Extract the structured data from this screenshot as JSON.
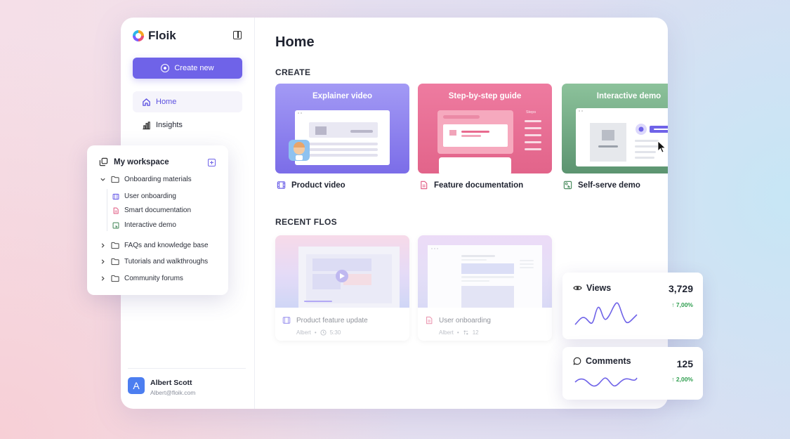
{
  "app": {
    "name": "Floik"
  },
  "sidebar": {
    "create_label": "Create new",
    "items": [
      {
        "label": "Home",
        "icon": "home-icon",
        "active": true
      },
      {
        "label": "Insights",
        "icon": "bar-chart-icon",
        "active": false
      }
    ],
    "user": {
      "initial": "A",
      "name": "Albert Scott",
      "email": "Albert@floik.com"
    }
  },
  "main": {
    "title": "Home",
    "create_heading": "CREATE",
    "create_cards": [
      {
        "title": "Explainer video",
        "label": "Product video",
        "icon": "film-icon",
        "color": "#8b7cf0"
      },
      {
        "title": "Step-by-step guide",
        "label": "Feature documentation",
        "icon": "document-icon",
        "color": "#e86a8e",
        "steps_caption": "Steps"
      },
      {
        "title": "Interactive demo",
        "label": "Self-serve demo",
        "icon": "interactive-icon",
        "color": "#6aa77e"
      }
    ],
    "recent_heading": "RECENT FLOS",
    "recent": [
      {
        "name": "Product feature update",
        "author": "Albert",
        "meta": "5:30",
        "icon": "film-icon",
        "meta_icon": "clock-icon"
      },
      {
        "name": "User onboarding",
        "author": "Albert",
        "meta": "12",
        "icon": "document-icon",
        "meta_icon": "steps-icon"
      }
    ]
  },
  "workspace": {
    "title": "My workspace",
    "folders": [
      {
        "label": "Onboarding materials",
        "expanded": true,
        "children": [
          {
            "label": "User onboarding",
            "icon": "film-icon"
          },
          {
            "label": "Smart documentation",
            "icon": "document-icon"
          },
          {
            "label": "Interactive demo",
            "icon": "interactive-icon"
          }
        ]
      },
      {
        "label": "FAQs and knowledge base",
        "expanded": false
      },
      {
        "label": "Tutorials and walkthroughs",
        "expanded": false
      },
      {
        "label": "Community forums",
        "expanded": false
      }
    ]
  },
  "stats": {
    "views": {
      "label": "Views",
      "value": "3,729",
      "change": "7,00%",
      "icon": "eye-icon"
    },
    "comments": {
      "label": "Comments",
      "value": "125",
      "change": "2,00%",
      "icon": "comment-icon"
    }
  },
  "colors": {
    "accent": "#6f63e8",
    "positive": "#2f9e4f"
  }
}
